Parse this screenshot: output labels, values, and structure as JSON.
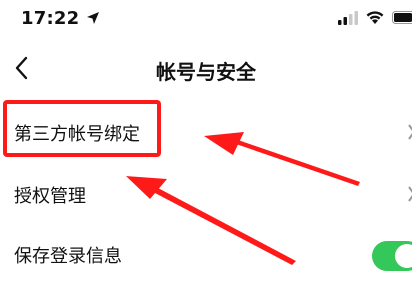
{
  "status_bar": {
    "time": "17:22",
    "location_icon": "location-arrow-icon",
    "signal_icon": "cellular-signal-icon",
    "wifi_icon": "wifi-icon",
    "battery_icon": "battery-icon"
  },
  "nav": {
    "back_icon": "chevron-left-icon",
    "title": "帐号与安全"
  },
  "rows": [
    {
      "label": "第三方帐号绑定",
      "control": "chevron"
    },
    {
      "label": "授权管理",
      "control": "chevron"
    },
    {
      "label": "保存登录信息",
      "control": "toggle",
      "toggle_on": true
    }
  ],
  "annotation": {
    "color": "#ff1a1a"
  },
  "colors": {
    "toggle_on": "#34c759",
    "text": "#111111",
    "background": "#ffffff"
  }
}
